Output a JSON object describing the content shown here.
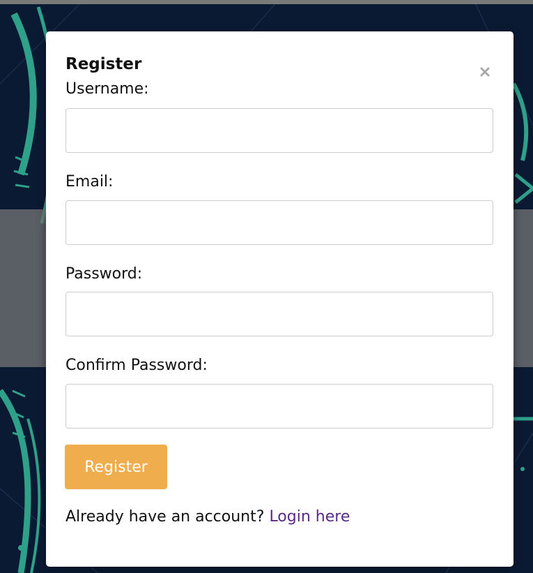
{
  "modal": {
    "title": "Register",
    "close_icon": "close-icon",
    "fields": [
      {
        "label": "Username:",
        "value": "",
        "placeholder": ""
      },
      {
        "label": "Email:",
        "value": "",
        "placeholder": ""
      },
      {
        "label": "Password:",
        "value": "",
        "placeholder": ""
      },
      {
        "label": "Confirm Password:",
        "value": "",
        "placeholder": ""
      }
    ],
    "submit_label": "Register",
    "login_prompt": "Already have an account?",
    "login_link": "Login here"
  },
  "colors": {
    "background": "#0b1a33",
    "accent_lines": "#2fa08a",
    "button": "#f0ad4e",
    "link": "#5b2a86"
  }
}
